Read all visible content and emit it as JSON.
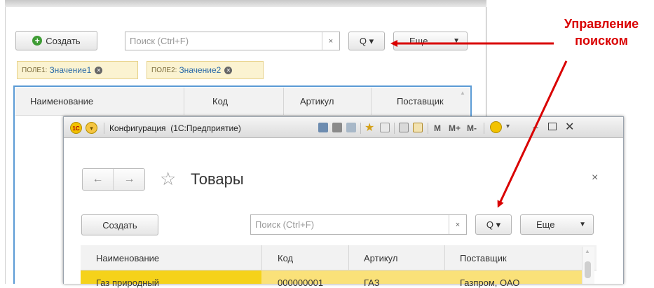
{
  "back_window": {
    "create_label": "Создать",
    "search_placeholder": "Поиск (Ctrl+F)",
    "clear_glyph": "×",
    "search_menu_glyph": "Q ▾",
    "more_label": "Еще",
    "filters": [
      {
        "key": "ПОЛЕ1:",
        "value": "Значение1"
      },
      {
        "key": "ПОЛЕ2:",
        "value": "Значение2"
      }
    ],
    "columns": [
      "Наименование",
      "Код",
      "Артикул",
      "Поставщик"
    ]
  },
  "front_window": {
    "title": "Конфигурация  (1С:Предприятие)",
    "toolbar_m_labels": [
      "M",
      "M+",
      "M-"
    ],
    "nav_back": "←",
    "nav_forward": "→",
    "favorite_glyph": "☆",
    "page_title": "Товары",
    "close_glyph": "×",
    "create_label": "Создать",
    "search_placeholder": "Поиск (Ctrl+F)",
    "clear_glyph": "×",
    "search_menu_glyph": "Q ▾",
    "more_label": "Еще",
    "columns": [
      "Наименование",
      "Код",
      "Артикул",
      "Поставщик"
    ],
    "rows": [
      [
        "Газ природный",
        "000000001",
        "ГАЗ",
        "Газпром, ОАО"
      ]
    ]
  },
  "annotation": {
    "text_line1": "Управление",
    "text_line2": "поиском",
    "color": "#d90000"
  }
}
